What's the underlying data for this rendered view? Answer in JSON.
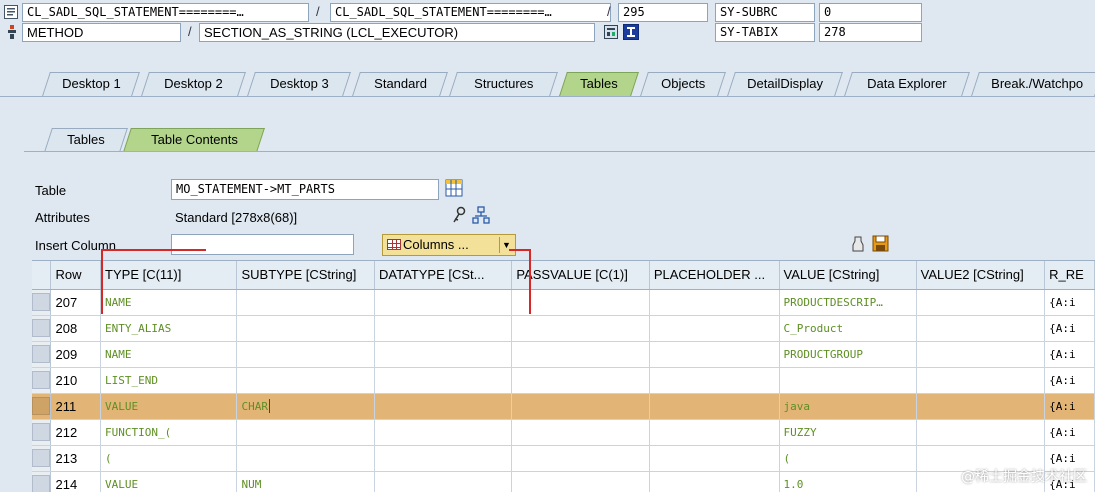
{
  "header": {
    "row1": {
      "program": "CL_SADL_SQL_STATEMENT========…",
      "include": "CL_SADL_SQL_STATEMENT========…",
      "line": "295",
      "sysvar_name": "SY-SUBRC",
      "sysvar_value": "0"
    },
    "row2": {
      "type": "METHOD",
      "name": "SECTION_AS_STRING (LCL_EXECUTOR)",
      "sysvar_name": "SY-TABIX",
      "sysvar_value": "278"
    },
    "separator": "/"
  },
  "tabs": [
    {
      "label": "Desktop 1"
    },
    {
      "label": "Desktop 2"
    },
    {
      "label": "Desktop 3"
    },
    {
      "label": "Standard"
    },
    {
      "label": "Structures"
    },
    {
      "label": "Tables",
      "active": true
    },
    {
      "label": "Objects"
    },
    {
      "label": "DetailDisplay"
    },
    {
      "label": "Data Explorer"
    },
    {
      "label": "Break./Watchpo"
    }
  ],
  "subtabs": [
    {
      "label": "Tables"
    },
    {
      "label": "Table Contents",
      "active": true
    }
  ],
  "form": {
    "table_label": "Table",
    "table_value": "MO_STATEMENT->MT_PARTS",
    "attributes_label": "Attributes",
    "attributes_value": "Standard [278x8(68)]",
    "insert_label": "Insert Column",
    "insert_value": "",
    "columns_button": "Columns ..."
  },
  "grid": {
    "columns": [
      "Row",
      "TYPE [C(11)]",
      "SUBTYPE [CString]",
      "DATATYPE [CSt...",
      "PASSVALUE [C(1)]",
      "PLACEHOLDER ...",
      "VALUE [CString]",
      "VALUE2 [CString]",
      "R_RE"
    ],
    "rows": [
      {
        "row": "207",
        "type": "NAME",
        "subtype": "",
        "datatype": "",
        "passvalue": "",
        "placeholder": "",
        "value": "PRODUCTDESCRIP…",
        "value2": "",
        "rref": "{A:i"
      },
      {
        "row": "208",
        "type": "ENTY_ALIAS",
        "subtype": "",
        "datatype": "",
        "passvalue": "",
        "placeholder": "",
        "value": "C_Product",
        "value2": "",
        "rref": "{A:i"
      },
      {
        "row": "209",
        "type": "NAME",
        "subtype": "",
        "datatype": "",
        "passvalue": "",
        "placeholder": "",
        "value": "PRODUCTGROUP",
        "value2": "",
        "rref": "{A:i"
      },
      {
        "row": "210",
        "type": "LIST_END",
        "subtype": "",
        "datatype": "",
        "passvalue": "",
        "placeholder": "",
        "value": "",
        "value2": "",
        "rref": "{A:i"
      },
      {
        "row": "211",
        "type": "VALUE",
        "subtype": "CHAR",
        "datatype": "",
        "passvalue": "",
        "placeholder": "",
        "value": "java",
        "value2": "",
        "rref": "{A:i",
        "highlighted": true
      },
      {
        "row": "212",
        "type": "FUNCTION_(",
        "subtype": "",
        "datatype": "",
        "passvalue": "",
        "placeholder": "",
        "value": "FUZZY",
        "value2": "",
        "rref": "{A:i"
      },
      {
        "row": "213",
        "type": "(",
        "subtype": "",
        "datatype": "",
        "passvalue": "",
        "placeholder": "",
        "value": "(",
        "value2": "",
        "rref": "{A:i"
      },
      {
        "row": "214",
        "type": "VALUE",
        "subtype": "NUM",
        "datatype": "",
        "passvalue": "",
        "placeholder": "",
        "value": "1.0",
        "value2": "",
        "rref": "{A:i"
      }
    ]
  },
  "watermark": "@稀土掘金技术社区",
  "colors": {
    "active_tab": "#b3d58b",
    "highlight_row": "#e2b576",
    "cell_text": "#5e8f24",
    "annotation": "#d72828"
  }
}
